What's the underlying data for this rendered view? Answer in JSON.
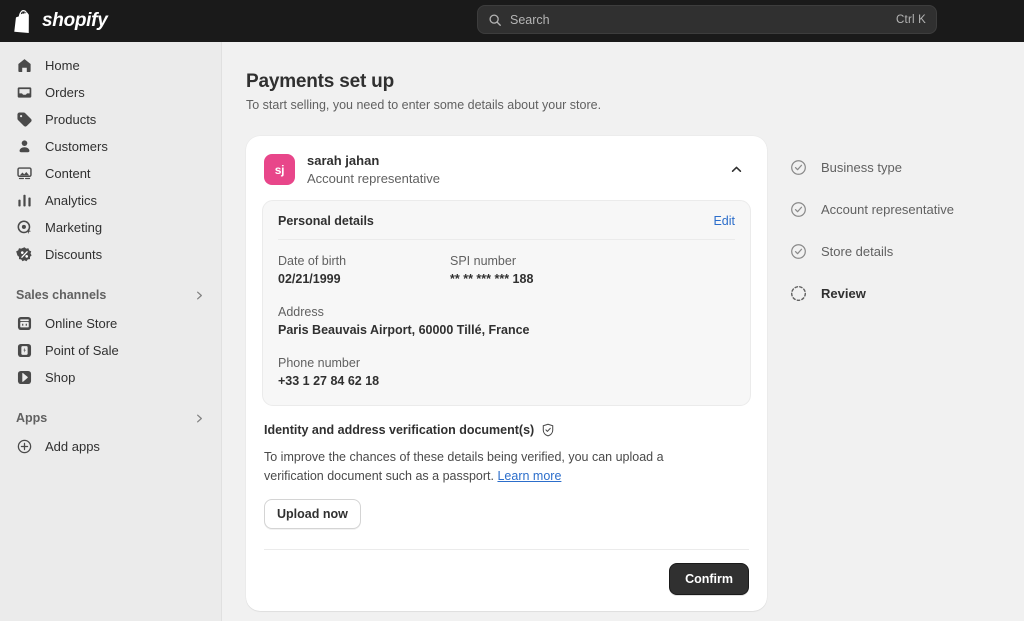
{
  "topbar": {
    "brand": "shopify",
    "brand_icon": "shopify-bag-icon",
    "search": {
      "icon": "search-icon",
      "placeholder": "Search",
      "shortcut": "Ctrl K"
    }
  },
  "sidebar": {
    "items": [
      {
        "label": "Home",
        "icon": "home-icon"
      },
      {
        "label": "Orders",
        "icon": "orders-inbox-icon"
      },
      {
        "label": "Products",
        "icon": "product-tag-icon"
      },
      {
        "label": "Customers",
        "icon": "customer-person-icon"
      },
      {
        "label": "Content",
        "icon": "content-image-icon"
      },
      {
        "label": "Analytics",
        "icon": "analytics-bars-icon"
      },
      {
        "label": "Marketing",
        "icon": "marketing-target-icon"
      },
      {
        "label": "Discounts",
        "icon": "discount-percent-icon"
      }
    ],
    "sections": [
      {
        "label": "Sales channels",
        "chevron_icon": "chevron-right-icon",
        "items": [
          {
            "label": "Online Store",
            "icon": "online-store-icon"
          },
          {
            "label": "Point of Sale",
            "icon": "point-of-sale-icon"
          },
          {
            "label": "Shop",
            "icon": "shop-icon"
          }
        ]
      },
      {
        "label": "Apps",
        "chevron_icon": "chevron-right-icon",
        "items": [
          {
            "label": "Add apps",
            "icon": "plus-circle-icon"
          }
        ]
      }
    ]
  },
  "page": {
    "title": "Payments set up",
    "subtitle": "To start selling, you need to enter some details about your store."
  },
  "card": {
    "avatar_initials": "sj",
    "avatar_color": "#E8468A",
    "name": "sarah jahan",
    "role": "Account representative",
    "collapse_icon": "chevron-up-icon",
    "panel": {
      "title": "Personal details",
      "edit_label": "Edit",
      "fields": [
        {
          "label": "Date of birth",
          "value": "02/21/1999"
        },
        {
          "label": "SPI number",
          "value": "** ** *** *** 188"
        },
        {
          "label": "Address",
          "value": "Paris Beauvais Airport, 60000 Tillé, France"
        },
        {
          "label": "Phone number",
          "value": "+33 1 27 84 62 18"
        }
      ]
    },
    "verification": {
      "title": "Identity and address verification document(s)",
      "icon": "shield-check-icon",
      "body_before_link": "To improve the chances of these details being verified, you can upload a verification document such as a passport. ",
      "link_label": "Learn more",
      "upload_label": "Upload now"
    },
    "confirm_label": "Confirm"
  },
  "stepper": {
    "steps": [
      {
        "label": "Business type",
        "state": "complete",
        "icon": "check-circle-icon"
      },
      {
        "label": "Account representative",
        "state": "complete",
        "icon": "check-circle-icon"
      },
      {
        "label": "Store details",
        "state": "complete",
        "icon": "check-circle-icon"
      },
      {
        "label": "Review",
        "state": "active",
        "icon": "dashed-circle-icon"
      }
    ]
  },
  "colors": {
    "topbar_bg": "#1A1A1A",
    "sidebar_bg": "#EBEBEB",
    "page_bg": "#F1F1F1",
    "accent_link": "#2C6ECB",
    "primary_button": "#303030"
  }
}
